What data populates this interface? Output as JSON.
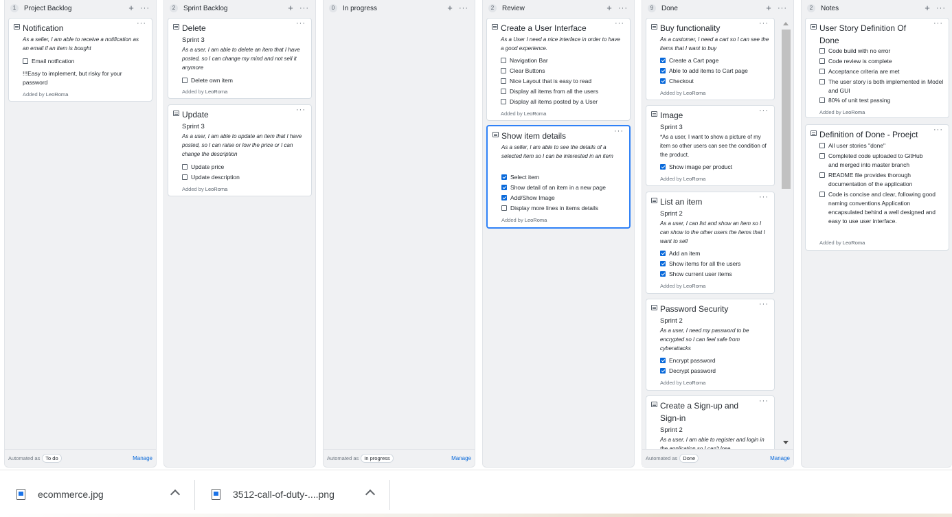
{
  "board": {
    "columns": [
      {
        "count": "1",
        "title": "Project Backlog",
        "footer": {
          "auto_label": "Automated as",
          "pill": "To do",
          "manage": "Manage"
        },
        "cards": [
          {
            "title": "Notification",
            "desc": "As a seller, I am able to receive a notification as an email if an item is bought",
            "items": [
              {
                "label": "Email notfication",
                "checked": false
              }
            ],
            "text": "!!!Easy to implement, but risky for your password",
            "added_prefix": "Added by",
            "author": "LeoRoma"
          }
        ]
      },
      {
        "count": "2",
        "title": "Sprint Backlog",
        "cards": [
          {
            "title": "Delete",
            "sprint": "Sprint 3",
            "desc": "As a user, I am able to delete an item that I have posted, so I can change my mind and not sell it anymore",
            "items": [
              {
                "label": "Delete own item",
                "checked": false
              }
            ],
            "added_prefix": "Added by",
            "author": "LeoRoma"
          },
          {
            "title": "Update",
            "sprint": "Sprint 3",
            "desc": "As a user, I am able to update an item that I have posted, so I can raise or low the price or I can change the description",
            "items": [
              {
                "label": "Update price",
                "checked": false
              },
              {
                "label": "Update description",
                "checked": false
              }
            ],
            "added_prefix": "Added by",
            "author": "LeoRoma"
          }
        ]
      },
      {
        "count": "0",
        "title": "In progress",
        "footer": {
          "auto_label": "Automated as",
          "pill": "In progress",
          "manage": "Manage"
        },
        "cards": []
      },
      {
        "count": "2",
        "title": "Review",
        "cards": [
          {
            "title": "Create a User Interface",
            "desc": "As a User I need a nice interface in order to have a good experience.",
            "items": [
              {
                "label": "Navigation Bar",
                "checked": false
              },
              {
                "label": "Clear Buttons",
                "checked": false
              },
              {
                "label": "Nice Layout that is easy to read",
                "checked": false
              },
              {
                "label": "Display all items from all the users",
                "checked": false
              },
              {
                "label": "Display all items posted by a User",
                "checked": false
              }
            ],
            "added_prefix": "Added by",
            "author": "LeoRoma"
          },
          {
            "title": "Show item details",
            "desc": "As a seller, I am able to see the details of a selected item so I can be interested in an item",
            "items": [
              {
                "label": "Select item",
                "checked": true
              },
              {
                "label": "Show detail of an item in a new page",
                "checked": true
              },
              {
                "label": "Add/Show Image",
                "checked": true
              },
              {
                "label": "Display more lines in items details",
                "checked": false
              }
            ],
            "added_prefix": "Added by",
            "author": "LeoRoma"
          }
        ]
      },
      {
        "count": "9",
        "title": "Done",
        "footer": {
          "auto_label": "Automated as",
          "pill": "Done",
          "manage": "Manage"
        },
        "cards": [
          {
            "title": "Buy functionality",
            "desc": "As a customer, I need a cart so I can see the items that I want to buy",
            "items": [
              {
                "label": "Create a Cart page",
                "checked": true
              },
              {
                "label": "Able to add items to Cart page",
                "checked": true
              },
              {
                "label": "Checkout",
                "checked": true
              }
            ],
            "added_prefix": "Added by",
            "author": "LeoRoma"
          },
          {
            "title": "Image",
            "sprint": "Sprint 3",
            "desc_plain": "*As a user, I want to show a picture of my item so other users can see the condition of the product.",
            "items": [
              {
                "label": "Show image per product",
                "checked": true
              }
            ],
            "added_prefix": "Added by",
            "author": "LeoRoma"
          },
          {
            "title": "List an item",
            "sprint": "Sprint 2",
            "desc": "As a user, I can list and show an item so I can show to the other users the items that I want to sell",
            "items": [
              {
                "label": "Add an item",
                "checked": true
              },
              {
                "label": "Show items for all the users",
                "checked": true
              },
              {
                "label": "Show current user items",
                "checked": true
              }
            ],
            "added_prefix": "Added by",
            "author": "LeoRoma"
          },
          {
            "title": "Password Security",
            "sprint": "Sprint 2",
            "desc": "As a user, I need my password to be encrypted so I can feel safe from cyberattacks",
            "items": [
              {
                "label": "Encrypt password",
                "checked": true
              },
              {
                "label": "Decrypt password",
                "checked": true
              }
            ],
            "added_prefix": "Added by",
            "author": "LeoRoma"
          },
          {
            "title": "Create a Sign-up and Sign-in",
            "sprint": "Sprint 2",
            "desc": "As a user, I am able to register and login in the application so I can't lose"
          }
        ]
      },
      {
        "count": "2",
        "title": "Notes",
        "cards": [
          {
            "title": "User Story Definition Of Done",
            "items": [
              {
                "label": "Code build with no error",
                "checked": false
              },
              {
                "label": "Code review is complete",
                "checked": false
              },
              {
                "label": "Acceptance criteria are met",
                "checked": false
              },
              {
                "label": "The user story is both implemented in Model and GUI",
                "checked": false
              },
              {
                "label": "80% of unit test passing",
                "checked": false
              }
            ],
            "added_prefix": "Added by",
            "author": "LeoRoma"
          },
          {
            "title": "Definition of Done - Proejct",
            "items": [
              {
                "label": "All user stories \"done\"",
                "checked": false
              },
              {
                "label": "Completed code uploaded to GitHub and merged into master branch",
                "checked": false
              },
              {
                "label": "README file provides thorough documentation of the application",
                "checked": false
              },
              {
                "label": "Code is concise and clear, following good naming conventions Application encapsulated behind a well designed and easy to use user interface.",
                "checked": false
              }
            ],
            "added_prefix": "Added by",
            "author": "LeoRoma"
          }
        ]
      }
    ],
    "icons": {
      "add": "+",
      "more": "···"
    }
  },
  "downloads": [
    {
      "name": "ecommerce.jpg"
    },
    {
      "name": "3512-call-of-duty-....png"
    }
  ]
}
